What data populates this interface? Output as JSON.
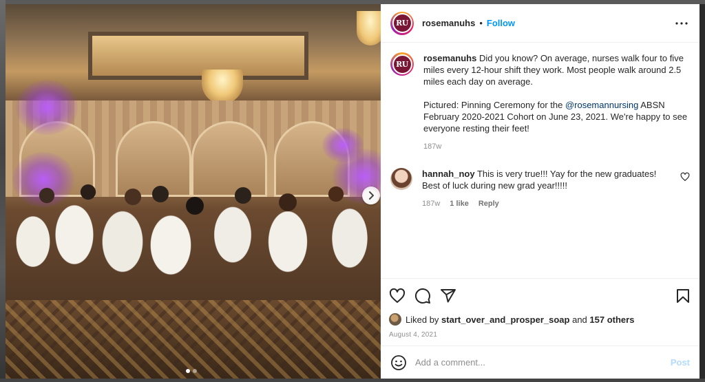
{
  "post": {
    "author": {
      "username": "rosemanuhs",
      "avatar_text": "RU",
      "follow_label": "Follow",
      "separator": "•"
    },
    "caption": {
      "username": "rosemanuhs",
      "text_line1": "Did you know? On average, nurses walk four to five miles every 12-hour shift they work. Most people walk around 2.5 miles each day on average.",
      "text_line2_prefix": "Pictured: Pinning Ceremony for the ",
      "mention": "@rosemannursing",
      "text_line2_suffix": " ABSN February 2020-2021 Cohort on June 23, 2021. We're happy to see everyone resting their feet!",
      "time": "187w"
    },
    "comments": [
      {
        "username": "hannah_noy",
        "text": "This is very true!!! Yay for the new graduates! Best of luck during new grad year!!!!!",
        "time": "187w",
        "likes": "1 like",
        "reply_label": "Reply"
      }
    ],
    "likes": {
      "prefix": "Liked by ",
      "user": "start_over_and_prosper_soap",
      "middle": " and ",
      "others": "157 others"
    },
    "date": "August 4, 2021",
    "add_comment": {
      "placeholder": "Add a comment...",
      "post_label": "Post"
    },
    "carousel": {
      "total": 2,
      "active": 1
    }
  },
  "icons": {
    "more": "more-options-icon",
    "like": "heart-icon",
    "comment": "comment-icon",
    "share": "share-icon",
    "save": "bookmark-icon",
    "emoji": "emoji-icon",
    "next": "chevron-right-icon"
  },
  "colors": {
    "accent": "#0095f6",
    "post_disabled": "#b3dbff",
    "mention": "#00376b",
    "muted": "#8e8e8e"
  }
}
